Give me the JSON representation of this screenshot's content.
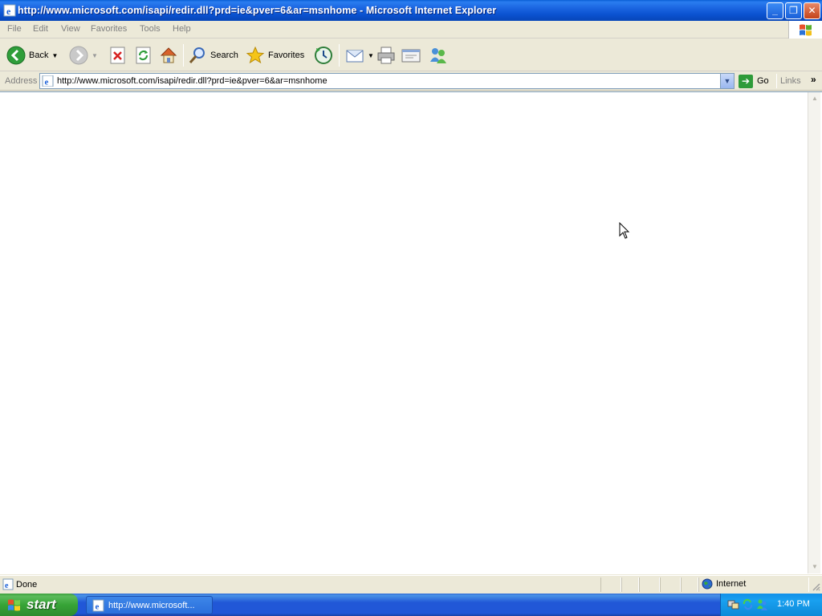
{
  "window": {
    "title": "http://www.microsoft.com/isapi/redir.dll?prd=ie&pver=6&ar=msnhome - Microsoft Internet Explorer",
    "controls": {
      "minimize": "_",
      "restore": "❐",
      "close": "✕"
    }
  },
  "menu": [
    "File",
    "Edit",
    "View",
    "Favorites",
    "Tools",
    "Help"
  ],
  "toolbar": {
    "back_label": "Back",
    "search_label": "Search",
    "favorites_label": "Favorites"
  },
  "address": {
    "label": "Address",
    "url": "http://www.microsoft.com/isapi/redir.dll?prd=ie&pver=6&ar=msnhome",
    "go_label": "Go",
    "links_label": "Links"
  },
  "status": {
    "text": "Done",
    "zone": "Internet"
  },
  "taskbar": {
    "start_label": "start",
    "task_label": "http://www.microsoft...",
    "clock": "1:40 PM"
  },
  "colors": {
    "title_bar": "#0a52d0",
    "taskbar": "#2157d7",
    "start_button": "#37a437",
    "chrome": "#ece9d8"
  }
}
